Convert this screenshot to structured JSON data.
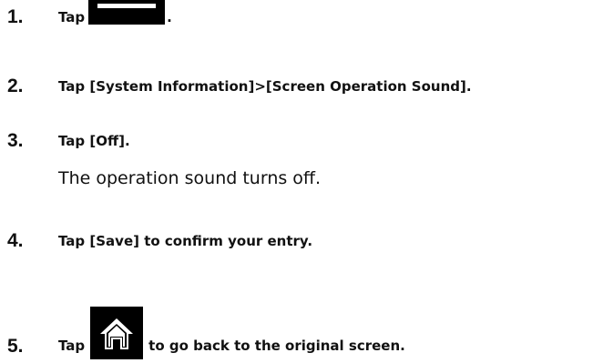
{
  "steps": [
    {
      "number": "1.",
      "text_before": "Tap",
      "icon": "menu-icon",
      "text_after": "."
    },
    {
      "number": "2.",
      "text": "Tap [System Information]>[Screen Operation Sound]."
    },
    {
      "number": "3.",
      "text": "Tap [Off].",
      "result": "The operation sound turns off."
    },
    {
      "number": "4.",
      "text": "Tap [Save] to confirm your entry."
    },
    {
      "number": "5.",
      "text_before": "Tap",
      "icon": "home-icon",
      "text_after": "to go back to the original screen."
    }
  ],
  "colors": {
    "text": "#111111",
    "icon_background": "#000000",
    "icon_foreground": "#ffffff"
  }
}
